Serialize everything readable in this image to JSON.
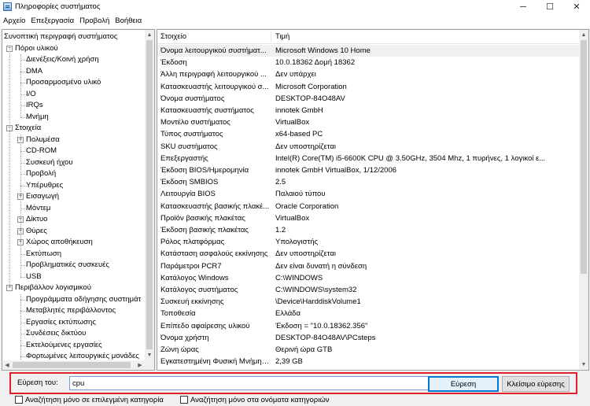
{
  "window": {
    "title": "Πληροφορίες συστήματος",
    "controls": {
      "minimize": "─",
      "maximize": "☐",
      "close": "✕"
    }
  },
  "menu": [
    "Αρχείο",
    "Επεξεργασία",
    "Προβολή",
    "Βοήθεια"
  ],
  "tree": {
    "items": [
      {
        "label": "Συνοπτική περιγραφή συστήματος",
        "level": 0,
        "expander": ""
      },
      {
        "label": "Πόροι υλικού",
        "level": 1,
        "expander": "−"
      },
      {
        "label": "Διενέξεις/Κοινή χρήση",
        "level": 2,
        "expander": ""
      },
      {
        "label": "DMA",
        "level": 2,
        "expander": ""
      },
      {
        "label": "Προσαρμοσμένο υλικό",
        "level": 2,
        "expander": ""
      },
      {
        "label": "I/O",
        "level": 2,
        "expander": ""
      },
      {
        "label": "IRQs",
        "level": 2,
        "expander": ""
      },
      {
        "label": "Μνήμη",
        "level": 2,
        "expander": ""
      },
      {
        "label": "Στοιχεία",
        "level": 1,
        "expander": "−"
      },
      {
        "label": "Πολυμέσα",
        "level": 2,
        "expander": "+"
      },
      {
        "label": "CD-ROM",
        "level": 2,
        "expander": ""
      },
      {
        "label": "Συσκευή ήχου",
        "level": 2,
        "expander": ""
      },
      {
        "label": "Προβολή",
        "level": 2,
        "expander": ""
      },
      {
        "label": "Υπέρυθρες",
        "level": 2,
        "expander": ""
      },
      {
        "label": "Εισαγωγή",
        "level": 2,
        "expander": "+"
      },
      {
        "label": "Μόντεμ",
        "level": 2,
        "expander": ""
      },
      {
        "label": "Δίκτυο",
        "level": 2,
        "expander": "+"
      },
      {
        "label": "Θύρες",
        "level": 2,
        "expander": "+"
      },
      {
        "label": "Χώρος αποθήκευση",
        "level": 2,
        "expander": "+"
      },
      {
        "label": "Εκτύπωση",
        "level": 2,
        "expander": ""
      },
      {
        "label": "Προβληματικές συσκευές",
        "level": 2,
        "expander": ""
      },
      {
        "label": "USB",
        "level": 2,
        "expander": ""
      },
      {
        "label": "Περιβάλλον λογισμικού",
        "level": 1,
        "expander": "−"
      },
      {
        "label": "Προγράμματα οδήγησης συστημάτ",
        "level": 2,
        "expander": ""
      },
      {
        "label": "Μεταβλητές περιβάλλοντος",
        "level": 2,
        "expander": ""
      },
      {
        "label": "Εργασίες εκτύπωσης",
        "level": 2,
        "expander": ""
      },
      {
        "label": "Συνδέσεις δικτύου",
        "level": 2,
        "expander": ""
      },
      {
        "label": "Εκτελούμενες εργασίες",
        "level": 2,
        "expander": ""
      },
      {
        "label": "Φορτωμένες λειτουργικές μονάδες",
        "level": 2,
        "expander": ""
      }
    ],
    "scroll_arrows": {
      "up": "▲",
      "down": "▼",
      "left": "◀",
      "right": "▶"
    }
  },
  "list": {
    "columns": [
      "Στοιχείο",
      "Τιμή"
    ],
    "rows": [
      {
        "item": "Όνομα λειτουργικού συστήματ...",
        "value": "Microsoft Windows 10 Home"
      },
      {
        "item": "Έκδοση",
        "value": "10.0.18362 Δομή 18362"
      },
      {
        "item": "Άλλη περιγραφή λειτουργικού ...",
        "value": "Δεν υπάρχει"
      },
      {
        "item": "Κατασκευαστής λειτουργικού σ...",
        "value": "Microsoft Corporation"
      },
      {
        "item": "Όνομα συστήματος",
        "value": "DESKTOP-84O48AV"
      },
      {
        "item": "Κατασκευαστής συστήματος",
        "value": "innotek GmbH"
      },
      {
        "item": "Μοντέλο συστήματος",
        "value": "VirtualBox"
      },
      {
        "item": "Τύπος συστήματος",
        "value": "x64-based PC"
      },
      {
        "item": "SKU συστήματος",
        "value": "Δεν υποστηρίζεται"
      },
      {
        "item": "Επεξεργαστής",
        "value": "Intel(R) Core(TM) i5-6600K CPU @ 3.50GHz, 3504 Mhz, 1 πυρήνες, 1 λογικοί ε..."
      },
      {
        "item": "Έκδοση BIOS/Ημερομηνία",
        "value": "innotek GmbH VirtualBox, 1/12/2006"
      },
      {
        "item": "Έκδοση SMBIOS",
        "value": "2.5"
      },
      {
        "item": "Λειτουργία BIOS",
        "value": "Παλαιού τύπου"
      },
      {
        "item": "Κατασκευαστής βασικής πλακέ...",
        "value": "Oracle Corporation"
      },
      {
        "item": "Προϊόν βασικής πλακέτας",
        "value": "VirtualBox"
      },
      {
        "item": "Έκδοση βασικής πλακέτας",
        "value": "1.2"
      },
      {
        "item": "Ρόλος πλατφόρμας",
        "value": "Υπολογιστής"
      },
      {
        "item": "Κατάσταση ασφαλούς εκκίνησης",
        "value": "Δεν υποστηρίζεται"
      },
      {
        "item": "Παράμετροι PCR7",
        "value": "Δεν είναι δυνατή η σύνδεση"
      },
      {
        "item": "Κατάλογος Windows",
        "value": "C:\\WINDOWS"
      },
      {
        "item": "Κατάλογος συστήματος",
        "value": "C:\\WINDOWS\\system32"
      },
      {
        "item": "Συσκευή εκκίνησης",
        "value": "\\Device\\HarddiskVolume1"
      },
      {
        "item": "Τοποθεσία",
        "value": "Ελλάδα"
      },
      {
        "item": "Επίπεδο αφαίρεσης υλικού",
        "value": "Έκδοση = \"10.0.18362.356\""
      },
      {
        "item": "Όνομα χρήστη",
        "value": "DESKTOP-84O48AV\\PCsteps"
      },
      {
        "item": "Ζώνη ώρας",
        "value": "Θερινή ώρα GTB"
      },
      {
        "item": "Εγκατεστημένη Φυσική Μνήμη ...",
        "value": "2,39 GB"
      }
    ]
  },
  "find": {
    "label": "Εύρεση του:",
    "value": "cpu",
    "find_button": "Εύρεση",
    "close_button": "Κλείσιμο εύρεσης",
    "option_selected_category": "Αναζήτηση μόνο σε επιλεγμένη κατηγορία",
    "option_category_names": "Αναζήτηση μόνο στα ονόματα κατηγοριών"
  },
  "colors": {
    "highlight_border": "#e0202a",
    "default_button": "#0078d7"
  }
}
